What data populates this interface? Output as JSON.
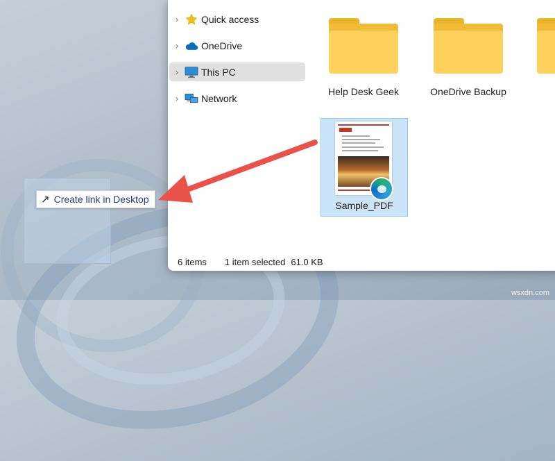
{
  "nav": {
    "items": [
      {
        "label": "Quick access",
        "icon": "star-icon"
      },
      {
        "label": "OneDrive",
        "icon": "cloud-icon"
      },
      {
        "label": "This PC",
        "icon": "monitor-icon",
        "selected": true
      },
      {
        "label": "Network",
        "icon": "network-icon"
      }
    ]
  },
  "content": {
    "folders": [
      {
        "label": "Help Desk Geek"
      },
      {
        "label": "OneDrive Backup"
      }
    ],
    "file": {
      "label": "Sample_PDF",
      "icon": "pdf-edge-icon"
    }
  },
  "status": {
    "count": "6 items",
    "selection": "1 item selected",
    "size": "61.0 KB"
  },
  "drag": {
    "tooltip": "Create link in Desktop",
    "icon": "link-arrow-icon"
  },
  "watermark": "wsxdn.com",
  "colors": {
    "arrow": "#e8524a",
    "selection": "#cce4f7",
    "folder": "#fdd15b"
  }
}
